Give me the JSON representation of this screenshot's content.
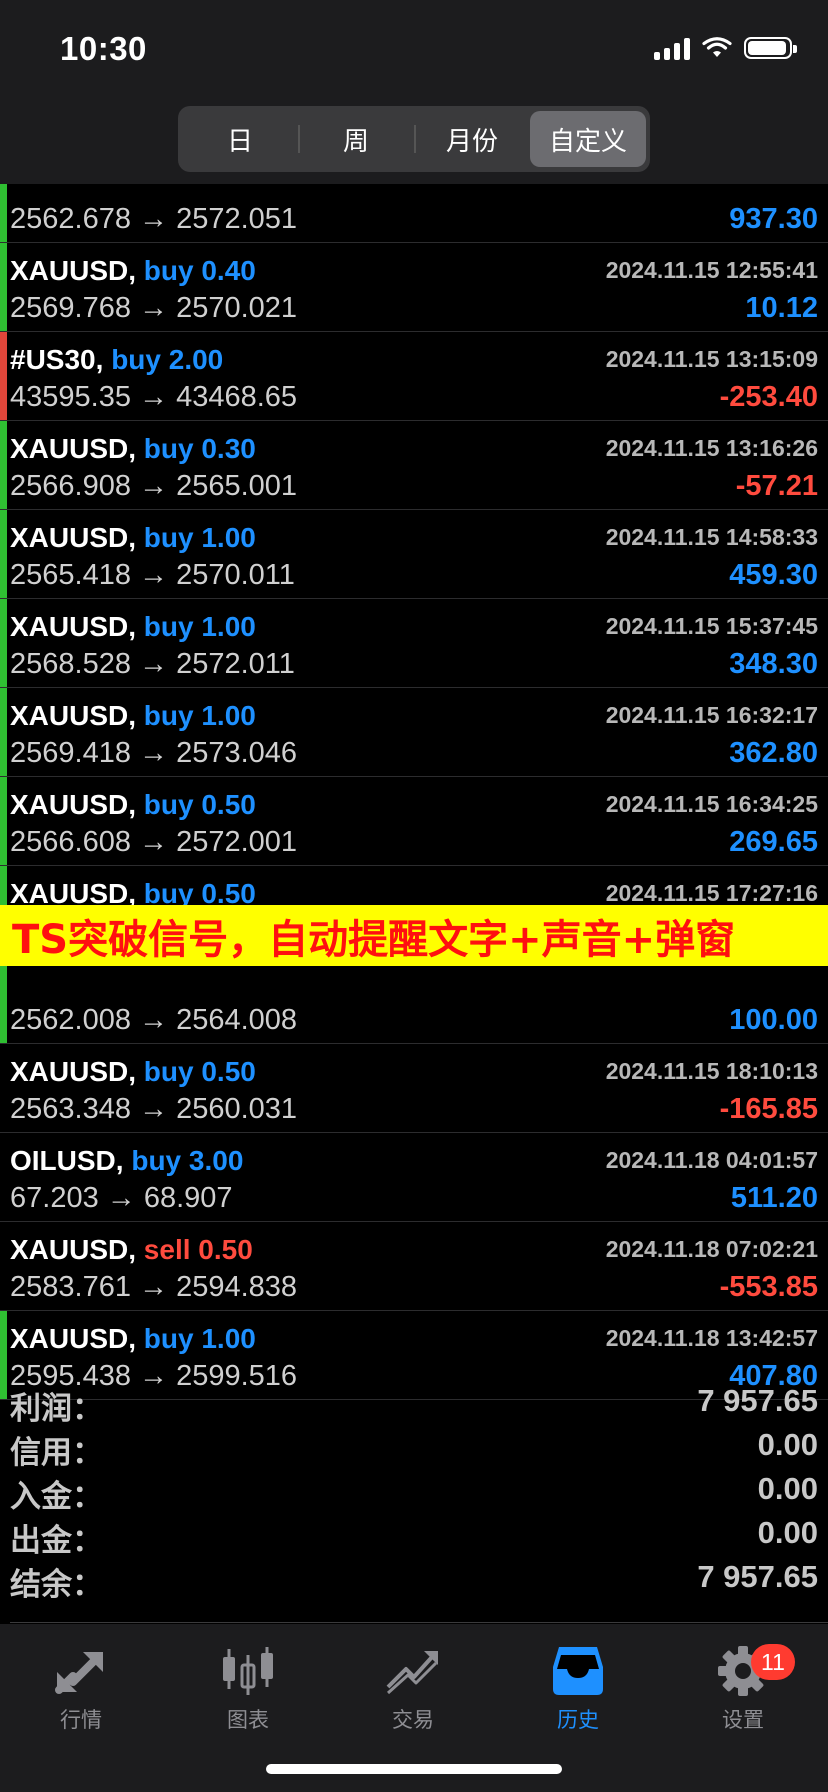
{
  "status_bar": {
    "time": "10:30"
  },
  "period_tabs": [
    {
      "label": "日",
      "active": false
    },
    {
      "label": "周",
      "active": false
    },
    {
      "label": "月份",
      "active": false
    },
    {
      "label": "自定义",
      "active": true
    }
  ],
  "trades": [
    {
      "symbol": "",
      "direction": "",
      "lots": "",
      "prices": "2562.678 → 2572.051",
      "date": "",
      "profit": "937.30",
      "side_color": "green"
    },
    {
      "symbol": "XAUUSD,",
      "direction": "buy",
      "lots": "0.40",
      "prices": "2569.768 → 2570.021",
      "date": "2024.11.15 12:55:41",
      "profit": "10.12",
      "side_color": "green"
    },
    {
      "symbol": "#US30,",
      "direction": "buy",
      "lots": "2.00",
      "prices": "43595.35 → 43468.65",
      "date": "2024.11.15 13:15:09",
      "profit": "-253.40",
      "side_color": "red"
    },
    {
      "symbol": "XAUUSD,",
      "direction": "buy",
      "lots": "0.30",
      "prices": "2566.908 → 2565.001",
      "date": "2024.11.15 13:16:26",
      "profit": "-57.21",
      "side_color": "green"
    },
    {
      "symbol": "XAUUSD,",
      "direction": "buy",
      "lots": "1.00",
      "prices": "2565.418 → 2570.011",
      "date": "2024.11.15 14:58:33",
      "profit": "459.30",
      "side_color": "green"
    },
    {
      "symbol": "XAUUSD,",
      "direction": "buy",
      "lots": "1.00",
      "prices": "2568.528 → 2572.011",
      "date": "2024.11.15 15:37:45",
      "profit": "348.30",
      "side_color": "green"
    },
    {
      "symbol": "XAUUSD,",
      "direction": "buy",
      "lots": "1.00",
      "prices": "2569.418 → 2573.046",
      "date": "2024.11.15 16:32:17",
      "profit": "362.80",
      "side_color": "green"
    },
    {
      "symbol": "XAUUSD,",
      "direction": "buy",
      "lots": "0.50",
      "prices": "2566.608 → 2572.001",
      "date": "2024.11.15 16:34:25",
      "profit": "269.65",
      "side_color": "green"
    },
    {
      "symbol": "XAUUSD,",
      "direction": "buy",
      "lots": "0.50",
      "prices": "",
      "date": "2024.11.15 17:27:16",
      "profit": "",
      "side_color": "green"
    },
    {
      "symbol": "",
      "direction": "",
      "lots": "",
      "prices": "2562.008 → 2564.008",
      "date": "",
      "profit": "100.00",
      "side_color": "green"
    },
    {
      "symbol": "XAUUSD,",
      "direction": "buy",
      "lots": "0.50",
      "prices": "2563.348 → 2560.031",
      "date": "2024.11.15 18:10:13",
      "profit": "-165.85",
      "side_color": "none"
    },
    {
      "symbol": "OILUSD,",
      "direction": "buy",
      "lots": "3.00",
      "prices": "67.203 → 68.907",
      "date": "2024.11.18 04:01:57",
      "profit": "511.20",
      "side_color": "none"
    },
    {
      "symbol": "XAUUSD,",
      "direction": "sell",
      "lots": "0.50",
      "prices": "2583.761 → 2594.838",
      "date": "2024.11.18 07:02:21",
      "profit": "-553.85",
      "side_color": "none"
    },
    {
      "symbol": "XAUUSD,",
      "direction": "buy",
      "lots": "1.00",
      "prices": "2595.438 → 2599.516",
      "date": "2024.11.18 13:42:57",
      "profit": "407.80",
      "side_color": "green"
    }
  ],
  "banner": {
    "text": "TS突破信号，自动提醒文字+声音+弹窗"
  },
  "summary": [
    {
      "label": "利润：",
      "value": "7 957.65"
    },
    {
      "label": "信用：",
      "value": "0.00"
    },
    {
      "label": "入金：",
      "value": "0.00"
    },
    {
      "label": "出金：",
      "value": "0.00"
    },
    {
      "label": "结余：",
      "value": "7 957.65"
    }
  ],
  "tabbar": {
    "quotes": "行情",
    "chart": "图表",
    "trade": "交易",
    "history": "历史",
    "settings": "设置",
    "settings_badge": "11"
  },
  "colors": {
    "buy": "#1e90ff",
    "sell": "#ff4b3e",
    "profit_long": "#2fbf32",
    "banner_bg": "#ffff00",
    "banner_text": "#ff1010"
  }
}
